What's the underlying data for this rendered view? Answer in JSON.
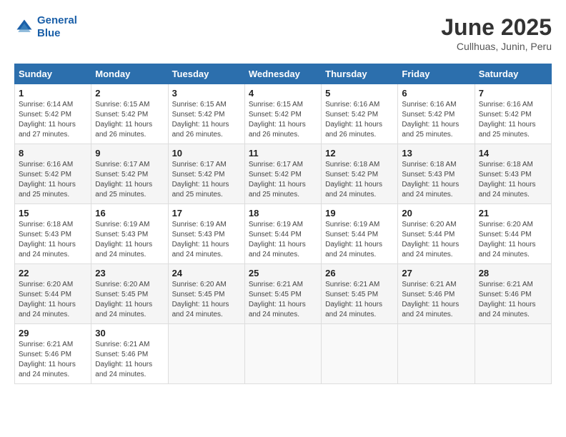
{
  "header": {
    "logo_line1": "General",
    "logo_line2": "Blue",
    "title": "June 2025",
    "subtitle": "Cullhuas, Junin, Peru"
  },
  "calendar": {
    "days_of_week": [
      "Sunday",
      "Monday",
      "Tuesday",
      "Wednesday",
      "Thursday",
      "Friday",
      "Saturday"
    ],
    "weeks": [
      [
        {
          "day": "",
          "info": ""
        },
        {
          "day": "2",
          "info": "Sunrise: 6:15 AM\nSunset: 5:42 PM\nDaylight: 11 hours\nand 26 minutes."
        },
        {
          "day": "3",
          "info": "Sunrise: 6:15 AM\nSunset: 5:42 PM\nDaylight: 11 hours\nand 26 minutes."
        },
        {
          "day": "4",
          "info": "Sunrise: 6:15 AM\nSunset: 5:42 PM\nDaylight: 11 hours\nand 26 minutes."
        },
        {
          "day": "5",
          "info": "Sunrise: 6:16 AM\nSunset: 5:42 PM\nDaylight: 11 hours\nand 26 minutes."
        },
        {
          "day": "6",
          "info": "Sunrise: 6:16 AM\nSunset: 5:42 PM\nDaylight: 11 hours\nand 25 minutes."
        },
        {
          "day": "7",
          "info": "Sunrise: 6:16 AM\nSunset: 5:42 PM\nDaylight: 11 hours\nand 25 minutes."
        }
      ],
      [
        {
          "day": "1",
          "info": "Sunrise: 6:14 AM\nSunset: 5:42 PM\nDaylight: 11 hours\nand 27 minutes."
        },
        {
          "day": "8",
          "info": "Sunrise: 6:17 AM\nSunset: 5:42 PM\nDaylight: 11 hours\nand 25 minutes."
        },
        {
          "day": "9",
          "info": "Sunrise: 6:17 AM\nSunset: 5:42 PM\nDaylight: 11 hours\nand 25 minutes."
        },
        {
          "day": "10",
          "info": "Sunrise: 6:17 AM\nSunset: 5:42 PM\nDaylight: 11 hours\nand 25 minutes."
        },
        {
          "day": "11",
          "info": "Sunrise: 6:17 AM\nSunset: 5:42 PM\nDaylight: 11 hours\nand 25 minutes."
        },
        {
          "day": "12",
          "info": "Sunrise: 6:18 AM\nSunset: 5:42 PM\nDaylight: 11 hours\nand 24 minutes."
        },
        {
          "day": "13",
          "info": "Sunrise: 6:18 AM\nSunset: 5:43 PM\nDaylight: 11 hours\nand 24 minutes."
        }
      ],
      [
        {
          "day": "14",
          "info": "Sunrise: 6:18 AM\nSunset: 5:43 PM\nDaylight: 11 hours\nand 24 minutes."
        },
        {
          "day": "15",
          "info": "Sunrise: 6:18 AM\nSunset: 5:43 PM\nDaylight: 11 hours\nand 24 minutes."
        },
        {
          "day": "16",
          "info": "Sunrise: 6:19 AM\nSunset: 5:43 PM\nDaylight: 11 hours\nand 24 minutes."
        },
        {
          "day": "17",
          "info": "Sunrise: 6:19 AM\nSunset: 5:43 PM\nDaylight: 11 hours\nand 24 minutes."
        },
        {
          "day": "18",
          "info": "Sunrise: 6:19 AM\nSunset: 5:44 PM\nDaylight: 11 hours\nand 24 minutes."
        },
        {
          "day": "19",
          "info": "Sunrise: 6:19 AM\nSunset: 5:44 PM\nDaylight: 11 hours\nand 24 minutes."
        },
        {
          "day": "20",
          "info": "Sunrise: 6:20 AM\nSunset: 5:44 PM\nDaylight: 11 hours\nand 24 minutes."
        }
      ],
      [
        {
          "day": "21",
          "info": "Sunrise: 6:20 AM\nSunset: 5:44 PM\nDaylight: 11 hours\nand 24 minutes."
        },
        {
          "day": "22",
          "info": "Sunrise: 6:20 AM\nSunset: 5:44 PM\nDaylight: 11 hours\nand 24 minutes."
        },
        {
          "day": "23",
          "info": "Sunrise: 6:20 AM\nSunset: 5:45 PM\nDaylight: 11 hours\nand 24 minutes."
        },
        {
          "day": "24",
          "info": "Sunrise: 6:20 AM\nSunset: 5:45 PM\nDaylight: 11 hours\nand 24 minutes."
        },
        {
          "day": "25",
          "info": "Sunrise: 6:21 AM\nSunset: 5:45 PM\nDaylight: 11 hours\nand 24 minutes."
        },
        {
          "day": "26",
          "info": "Sunrise: 6:21 AM\nSunset: 5:45 PM\nDaylight: 11 hours\nand 24 minutes."
        },
        {
          "day": "27",
          "info": "Sunrise: 6:21 AM\nSunset: 5:46 PM\nDaylight: 11 hours\nand 24 minutes."
        }
      ],
      [
        {
          "day": "28",
          "info": "Sunrise: 6:21 AM\nSunset: 5:46 PM\nDaylight: 11 hours\nand 24 minutes."
        },
        {
          "day": "29",
          "info": "Sunrise: 6:21 AM\nSunset: 5:46 PM\nDaylight: 11 hours\nand 24 minutes."
        },
        {
          "day": "30",
          "info": "Sunrise: 6:21 AM\nSunset: 5:46 PM\nDaylight: 11 hours\nand 24 minutes."
        },
        {
          "day": "",
          "info": ""
        },
        {
          "day": "",
          "info": ""
        },
        {
          "day": "",
          "info": ""
        },
        {
          "day": "",
          "info": ""
        }
      ]
    ]
  }
}
